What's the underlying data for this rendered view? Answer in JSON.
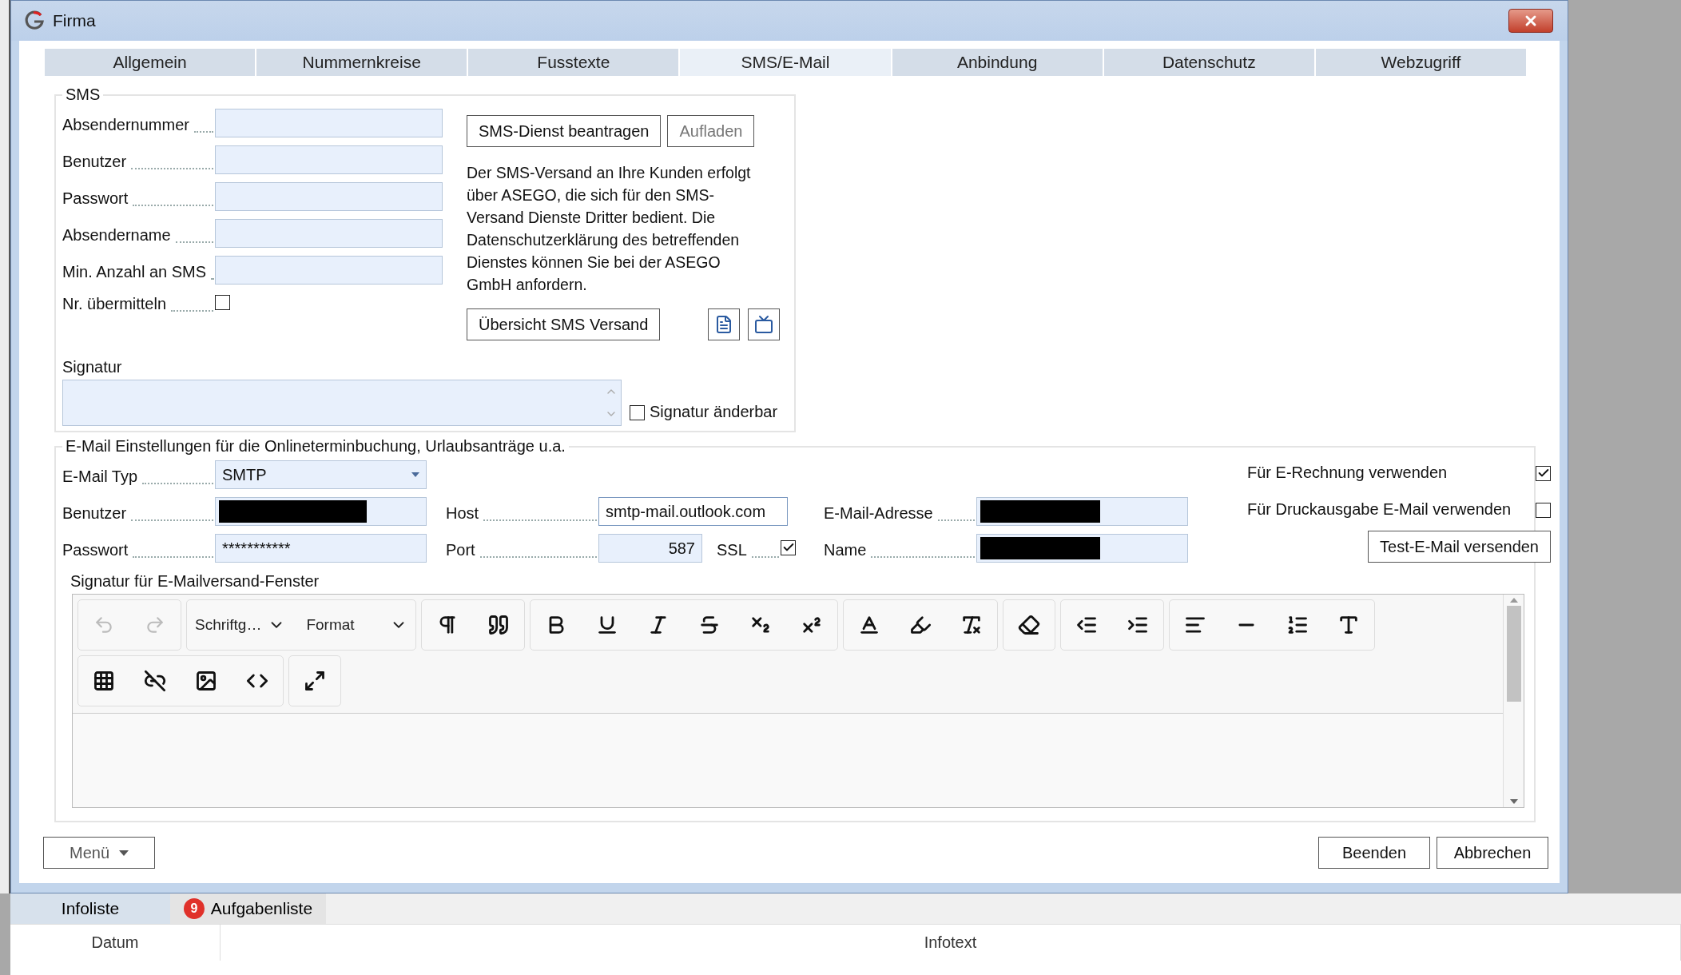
{
  "window": {
    "title": "Firma"
  },
  "tabs": [
    {
      "label": "Allgemein",
      "selected": false
    },
    {
      "label": "Nummernkreise",
      "selected": false
    },
    {
      "label": "Fusstexte",
      "selected": false
    },
    {
      "label": "SMS/E-Mail",
      "selected": true
    },
    {
      "label": "Anbindung",
      "selected": false
    },
    {
      "label": "Datenschutz",
      "selected": false
    },
    {
      "label": "Webzugriff",
      "selected": false
    }
  ],
  "sms": {
    "legend": "SMS",
    "fields": [
      {
        "label": "Absendernummer"
      },
      {
        "label": "Benutzer"
      },
      {
        "label": "Passwort"
      },
      {
        "label": "Absendername"
      },
      {
        "label": "Min. Anzahl an SMS"
      }
    ],
    "transmit_number": {
      "label": "Nr. übermitteln",
      "checked": false
    },
    "buttons": [
      {
        "label": "SMS-Dienst beantragen",
        "disabled": false
      },
      {
        "label": "Aufladen",
        "disabled": true
      }
    ],
    "info_text": "Der SMS-Versand an Ihre Kunden erfolgt über ASEGO, die sich für den SMS-Versand Dienste Dritter bedient. Die Datenschutzerklärung des betreffenden Dienstes können Sie bei der ASEGO GmbH anfordern.",
    "overview_button": "Übersicht SMS Versand",
    "signature": {
      "label": "Signatur"
    },
    "signature_editable": {
      "label": "Signatur änderbar",
      "checked": false
    }
  },
  "email": {
    "legend": "E-Mail Einstellungen für die Onlineterminbuchung, Urlaubsanträge u.a.",
    "type": {
      "label": "E-Mail Typ",
      "value": "SMTP"
    },
    "user": {
      "label": "Benutzer",
      "redacted": true
    },
    "password": {
      "label": "Passwort",
      "value": "***********"
    },
    "host": {
      "label": "Host",
      "value": "smtp-mail.outlook.com"
    },
    "port": {
      "label": "Port",
      "value": "587"
    },
    "ssl": {
      "label": "SSL",
      "checked": true
    },
    "address": {
      "label": "E-Mail-Adresse",
      "redacted": true
    },
    "name": {
      "label": "Name",
      "redacted": true
    },
    "options": [
      {
        "label": "Für E-Rechnung verwenden",
        "checked": true
      },
      {
        "label": "Für Druckausgabe E-Mail verwenden",
        "checked": false
      }
    ],
    "test_button": "Test-E-Mail versenden",
    "editor": {
      "label": "Signatur für E-Mailversand-Fenster",
      "font_dropdown": "Schriftg…",
      "format_dropdown": "Format",
      "undo_disabled": true,
      "redo_disabled": true
    }
  },
  "footer": {
    "menu_button": "Menü",
    "buttons": [
      "Beenden",
      "Abbrechen"
    ]
  },
  "bottom_panel": {
    "tabs": [
      {
        "label": "Infoliste",
        "selected": true
      },
      {
        "label": "Aufgabenliste",
        "selected": false,
        "badge": "9"
      }
    ],
    "columns": [
      "Datum",
      "Infotext"
    ]
  }
}
